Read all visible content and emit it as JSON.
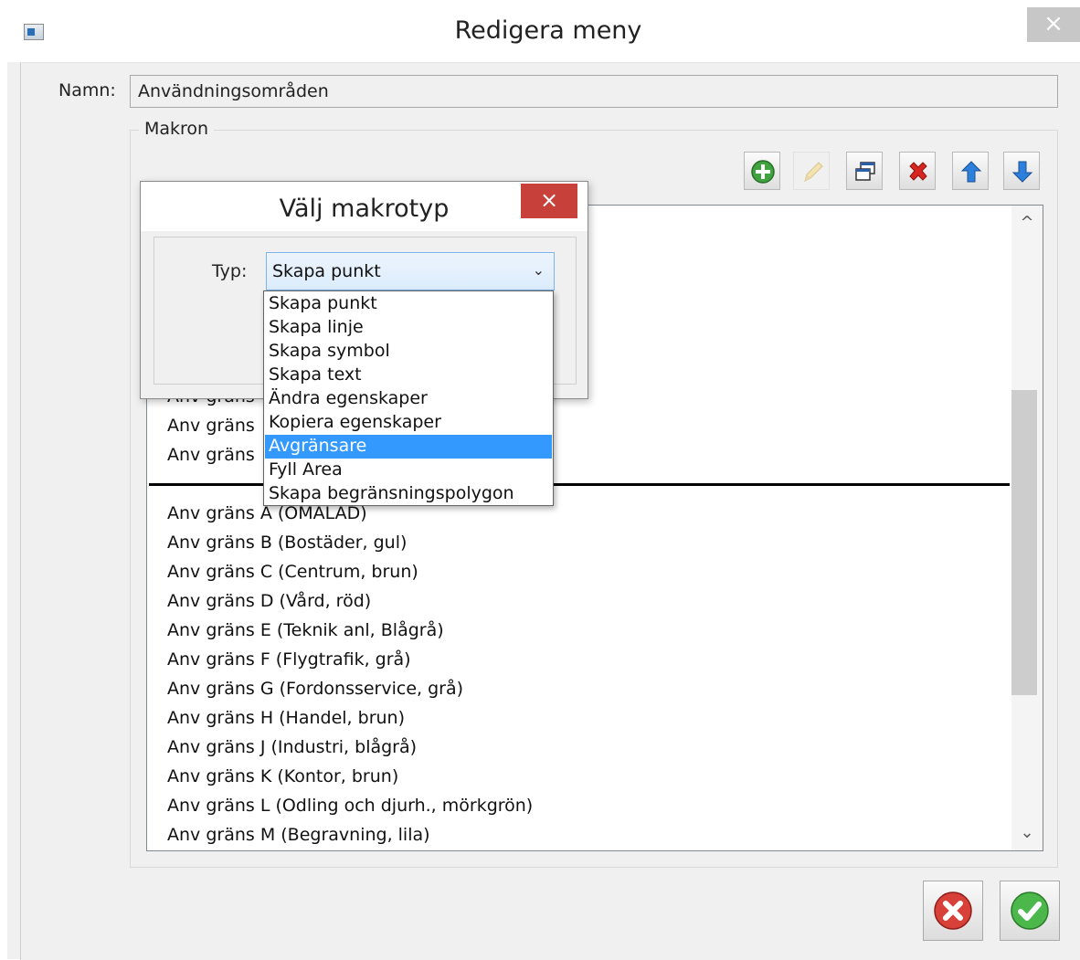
{
  "window": {
    "title": "Redigera meny",
    "close_glyph": "×"
  },
  "name_field": {
    "label": "Namn:",
    "value": "Användningsområden"
  },
  "macros": {
    "group_label": "Makron",
    "toolbar": [
      "add-icon",
      "edit-pencil-icon",
      "duplicate-window-icon",
      "delete-x-icon",
      "move-up-arrow-icon",
      "move-down-arrow-icon"
    ],
    "items_above_separator": [
      "Anv gräns",
      "Anv gräns",
      "Anv gräns"
    ],
    "items": [
      "Anv gräns A (OMALAD)",
      "Anv gräns B (Bostäder, gul)",
      "Anv gräns C (Centrum, brun)",
      "Anv gräns D (Vård, röd)",
      "Anv gräns E (Teknik anl, Blågrå)",
      "Anv gräns F (Flygtrafik, grå)",
      "Anv gräns G (Fordonsservice, grå)",
      "Anv gräns H (Handel, brun)",
      "Anv gräns J (Industri, blågrå)",
      "Anv gräns K (Kontor, brun)",
      "Anv gräns L (Odling och djurh., mörkgrön)",
      "Anv gräns M (Begravning, lila)"
    ],
    "scroll_up_glyph": "^",
    "scroll_down_glyph": "⌄"
  },
  "dialog": {
    "title": "Välj makrotyp",
    "close_glyph": "×",
    "type_label": "Typ:",
    "selected_value": "Skapa punkt",
    "combo_arrow_glyph": "⌄",
    "options": [
      "Skapa punkt",
      "Skapa linje",
      "Skapa symbol",
      "Skapa text",
      "Ändra egenskaper",
      "Kopiera egenskaper",
      "Avgränsare",
      "Fyll Area",
      "Skapa begränsningspolygon"
    ],
    "highlighted_option": "Avgränsare"
  },
  "bottom_buttons": [
    "cancel-red-x-icon",
    "ok-green-check-icon"
  ],
  "colors": {
    "selection": "#3399ff",
    "close_active": "#c8403a",
    "close_inactive": "#c7c7c7"
  }
}
